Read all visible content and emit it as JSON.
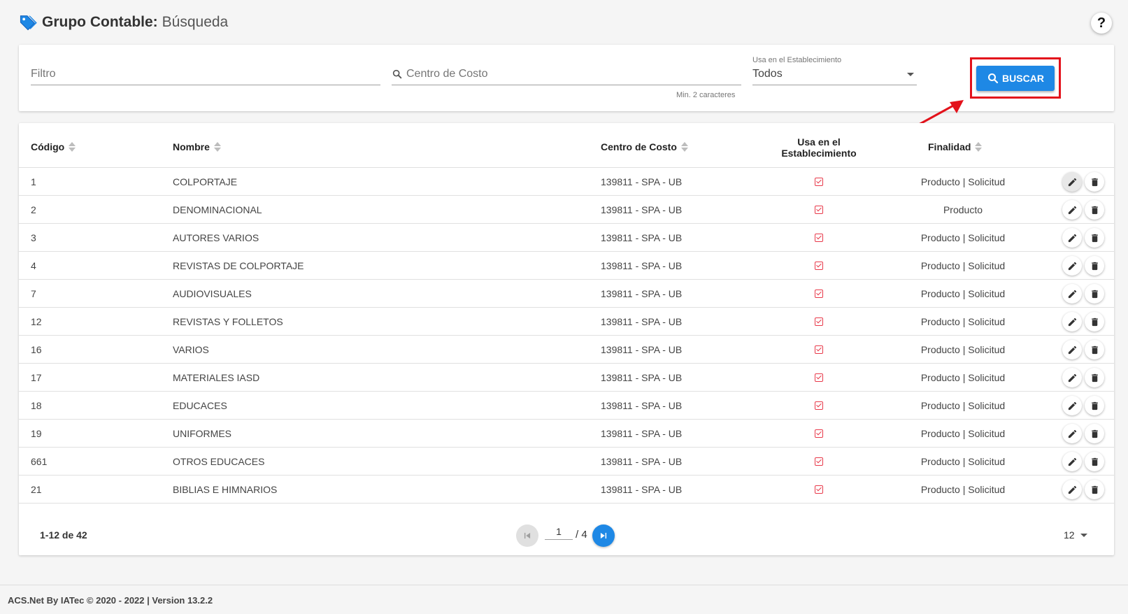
{
  "header": {
    "title": "Grupo Contable:",
    "subtitle": "Búsqueda",
    "help_label": "?"
  },
  "filters": {
    "filtro_placeholder": "Filtro",
    "cc_placeholder": "Centro de Costo",
    "cc_hint": "Min. 2 caracteres",
    "select_label": "Usa en el Establecimiento",
    "select_value": "Todos",
    "search_button": "BUSCAR"
  },
  "table": {
    "columns": {
      "codigo": "Código",
      "nombre": "Nombre",
      "centro": "Centro de Costo",
      "usa_line1": "Usa en el",
      "usa_line2": "Establecimiento",
      "finalidad": "Finalidad"
    },
    "rows": [
      {
        "codigo": "1",
        "nombre": "COLPORTAJE",
        "centro": "139811 - SPA - UB",
        "usa": true,
        "finalidad": "Producto | Solicitud"
      },
      {
        "codigo": "2",
        "nombre": "DENOMINACIONAL",
        "centro": "139811 - SPA - UB",
        "usa": true,
        "finalidad": "Producto"
      },
      {
        "codigo": "3",
        "nombre": "AUTORES VARIOS",
        "centro": "139811 - SPA - UB",
        "usa": true,
        "finalidad": "Producto | Solicitud"
      },
      {
        "codigo": "4",
        "nombre": "REVISTAS DE COLPORTAJE",
        "centro": "139811 - SPA - UB",
        "usa": true,
        "finalidad": "Producto | Solicitud"
      },
      {
        "codigo": "7",
        "nombre": "AUDIOVISUALES",
        "centro": "139811 - SPA - UB",
        "usa": true,
        "finalidad": "Producto | Solicitud"
      },
      {
        "codigo": "12",
        "nombre": "REVISTAS Y FOLLETOS",
        "centro": "139811 - SPA - UB",
        "usa": true,
        "finalidad": "Producto | Solicitud"
      },
      {
        "codigo": "16",
        "nombre": "VARIOS",
        "centro": "139811 - SPA - UB",
        "usa": true,
        "finalidad": "Producto | Solicitud"
      },
      {
        "codigo": "17",
        "nombre": "MATERIALES IASD",
        "centro": "139811 - SPA - UB",
        "usa": true,
        "finalidad": "Producto | Solicitud"
      },
      {
        "codigo": "18",
        "nombre": "EDUCACES",
        "centro": "139811 - SPA - UB",
        "usa": true,
        "finalidad": "Producto | Solicitud"
      },
      {
        "codigo": "19",
        "nombre": "UNIFORMES",
        "centro": "139811 - SPA - UB",
        "usa": true,
        "finalidad": "Producto | Solicitud"
      },
      {
        "codigo": "661",
        "nombre": "OTROS EDUCACES",
        "centro": "139811 - SPA - UB",
        "usa": true,
        "finalidad": "Producto | Solicitud"
      },
      {
        "codigo": "21",
        "nombre": "BIBLIAS E HIMNARIOS",
        "centro": "139811 - SPA - UB",
        "usa": true,
        "finalidad": "Producto | Solicitud"
      }
    ],
    "pagination": {
      "range": "1-12 de 42",
      "page": "1",
      "total": "/ 4",
      "per_page": "12"
    }
  },
  "footer": {
    "text": "ACS.Net By IATec © 2020 - 2022 | Version 13.2.2"
  },
  "colors": {
    "accent": "#1e88e5",
    "highlight": "#e3121b",
    "check": "#e8394a"
  }
}
